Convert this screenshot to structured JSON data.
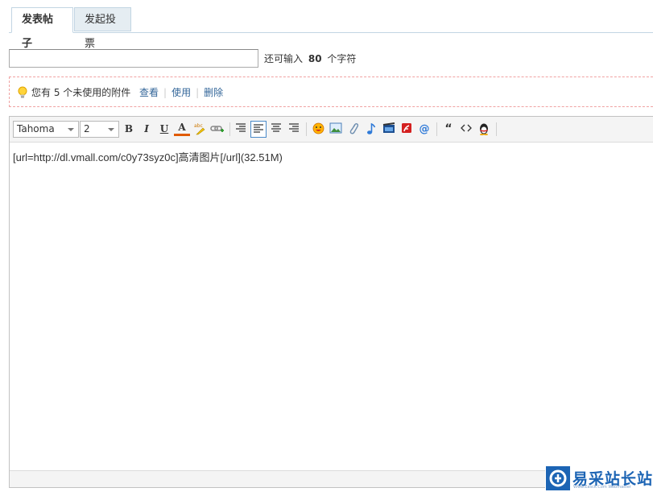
{
  "tabs": [
    {
      "label": "发表帖子",
      "active": true
    },
    {
      "label": "发起投票",
      "active": false
    }
  ],
  "subject": {
    "value": "",
    "counter_prefix": "还可输入",
    "counter_value": "80",
    "counter_suffix": "个字符"
  },
  "attachments_notice": {
    "text": "您有 5 个未使用的附件",
    "links": [
      "查看",
      "使用",
      "删除"
    ]
  },
  "editor": {
    "font_family": "Tahoma",
    "font_size": "2",
    "toolbar_buttons": [
      {
        "name": "bold-button",
        "label": "B"
      },
      {
        "name": "italic-button",
        "label": "I"
      },
      {
        "name": "underline-button",
        "label": "U"
      },
      {
        "name": "text-color-button",
        "label": "A"
      }
    ],
    "content": "[url=http://dl.vmall.com/c0y73syz0c]高清图片[/url](32.51M)"
  },
  "watermark": {
    "title": "易采站长站",
    "subtitle": "Www.Easck.Com Webmaster"
  },
  "colors": {
    "link": "#336699",
    "tab_border": "#c2d5e3",
    "notice_border": "#f0a2a2",
    "active_button_border": "#4a8ac8",
    "watermark": "#1c64b4"
  }
}
